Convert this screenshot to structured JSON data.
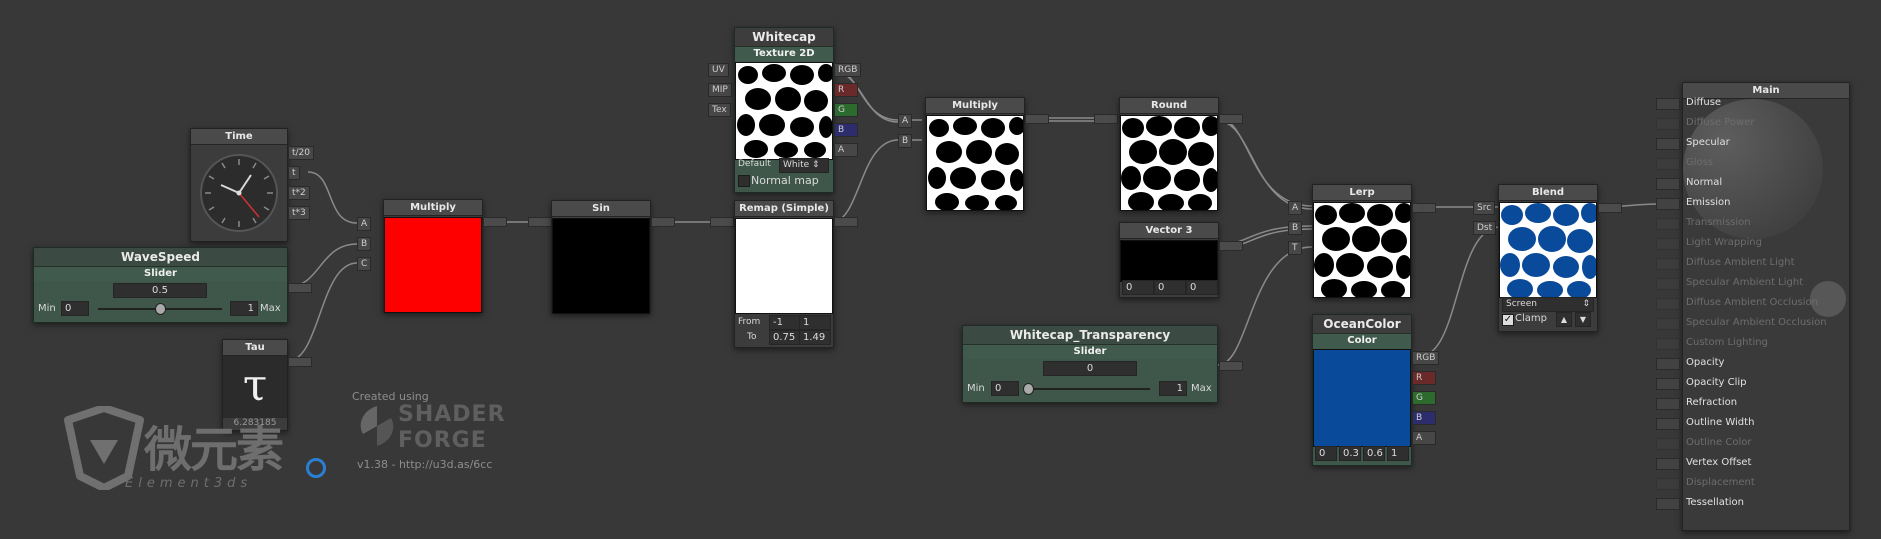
{
  "nodes": {
    "time": {
      "title": "Time",
      "outputs": [
        "t/20",
        "t",
        "t*2",
        "t*3"
      ]
    },
    "wavespeed": {
      "title": "WaveSpeed",
      "sub": "Slider",
      "value": "0.5",
      "min_label": "Min",
      "min": "0",
      "max": "1",
      "max_label": "Max"
    },
    "tau": {
      "title": "Tau",
      "value": "6.283185"
    },
    "multiply1": {
      "title": "Multiply",
      "inputs": [
        "A",
        "B",
        "C"
      ],
      "preview_color": "#ff0000"
    },
    "sin": {
      "title": "Sin",
      "preview_color": "#000000"
    },
    "whitecap": {
      "title": "Whitecap",
      "sub": "Texture 2D",
      "inputs": [
        "UV",
        "MIP",
        "Tex"
      ],
      "outputs": [
        "RGB",
        "R",
        "G",
        "B",
        "A"
      ],
      "default_label": "Default",
      "default_value": "White",
      "normal_map": "Normal map"
    },
    "remap": {
      "title": "Remap (Simple)",
      "from_label": "From",
      "from": [
        "-1",
        "1"
      ],
      "to_label": "To",
      "to": [
        "0.75",
        "1.49"
      ]
    },
    "multiply2": {
      "title": "Multiply",
      "inputs": [
        "A",
        "B"
      ]
    },
    "round": {
      "title": "Round"
    },
    "vector3": {
      "title": "Vector 3",
      "values": [
        "0",
        "0",
        "0"
      ]
    },
    "transparency": {
      "title": "Whitecap_Transparency",
      "sub": "Slider",
      "value": "0",
      "min_label": "Min",
      "min": "0",
      "max": "1",
      "max_label": "Max"
    },
    "lerp": {
      "title": "Lerp",
      "inputs": [
        "A",
        "B",
        "T"
      ]
    },
    "oceancolor": {
      "title": "OceanColor",
      "sub": "Color",
      "outputs": [
        "RGB",
        "R",
        "G",
        "B",
        "A"
      ],
      "values": [
        "0",
        "0.3",
        "0.6",
        "1"
      ],
      "color": "#0a4a9a"
    },
    "blend": {
      "title": "Blend",
      "inputs": [
        "Src",
        "Dst"
      ],
      "mode": "Screen",
      "clamp": "Clamp"
    }
  },
  "main": {
    "title": "Main",
    "rows": [
      {
        "label": "Diffuse",
        "active": true
      },
      {
        "label": "Diffuse Power",
        "active": false
      },
      {
        "label": "Specular",
        "active": true
      },
      {
        "label": "Gloss",
        "active": false
      },
      {
        "label": "Normal",
        "active": true
      },
      {
        "label": "Emission",
        "active": true
      },
      {
        "label": "Transmission",
        "active": false
      },
      {
        "label": "Light Wrapping",
        "active": false
      },
      {
        "label": "Diffuse Ambient Light",
        "active": false
      },
      {
        "label": "Specular Ambient Light",
        "active": false
      },
      {
        "label": "Diffuse Ambient Occlusion",
        "active": false
      },
      {
        "label": "Specular Ambient Occlusion",
        "active": false
      },
      {
        "label": "Custom Lighting",
        "active": false
      },
      {
        "label": "Opacity",
        "active": true
      },
      {
        "label": "Opacity Clip",
        "active": true
      },
      {
        "label": "Refraction",
        "active": true
      },
      {
        "label": "Outline Width",
        "active": true
      },
      {
        "label": "Outline Color",
        "active": false
      },
      {
        "label": "Vertex Offset",
        "active": true
      },
      {
        "label": "Displacement",
        "active": false
      },
      {
        "label": "Tessellation",
        "active": true
      }
    ]
  },
  "branding": {
    "created_using": "Created using",
    "shader": "SHADER",
    "forge": "FORGE",
    "version": "v1.38 - http://u3d.as/6cc",
    "watermark_cn": "微元素",
    "watermark_en": "Element3ds"
  },
  "colors": {
    "background": "#383838",
    "node_green": "#3f574b",
    "port_r": "#6a2a2a",
    "port_g": "#2d6a2d",
    "port_b": "#2d2d6e"
  }
}
